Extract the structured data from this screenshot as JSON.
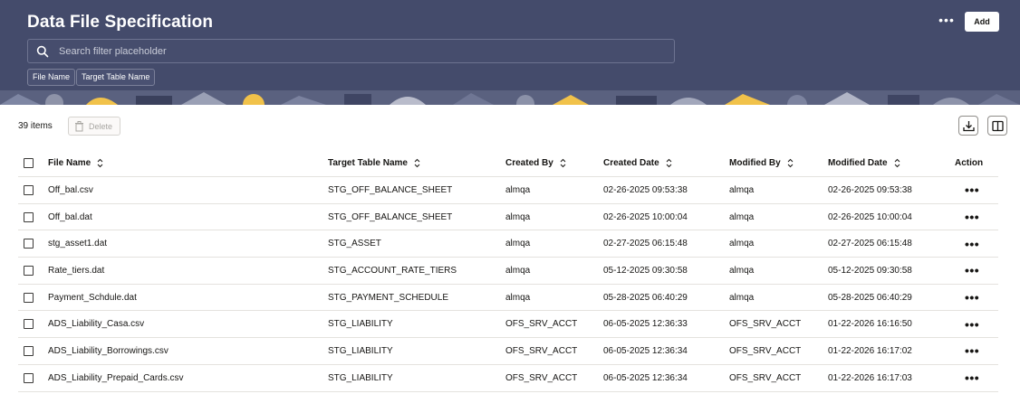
{
  "header": {
    "title": "Data File Specification",
    "search_placeholder": "Search filter placeholder",
    "chips": [
      "File Name",
      "Target Table Name"
    ],
    "more_label": "•••",
    "add_label": "Add",
    "background_color": "#444b6b"
  },
  "toolbar": {
    "item_count": "39 items",
    "delete_label": "Delete"
  },
  "table": {
    "columns": [
      "File Name",
      "Target Table Name",
      "Created By",
      "Created Date",
      "Modified By",
      "Modified Date",
      "Action"
    ],
    "action_label": "•••",
    "rows": [
      [
        "Off_bal.csv",
        "STG_OFF_BALANCE_SHEET",
        "almqa",
        "02-26-2025 09:53:38",
        "almqa",
        "02-26-2025 09:53:38"
      ],
      [
        "Off_bal.dat",
        "STG_OFF_BALANCE_SHEET",
        "almqa",
        "02-26-2025 10:00:04",
        "almqa",
        "02-26-2025 10:00:04"
      ],
      [
        "stg_asset1.dat",
        "STG_ASSET",
        "almqa",
        "02-27-2025 06:15:48",
        "almqa",
        "02-27-2025 06:15:48"
      ],
      [
        "Rate_tiers.dat",
        "STG_ACCOUNT_RATE_TIERS",
        "almqa",
        "05-12-2025 09:30:58",
        "almqa",
        "05-12-2025 09:30:58"
      ],
      [
        "Payment_Schdule.dat",
        "STG_PAYMENT_SCHEDULE",
        "almqa",
        "05-28-2025 06:40:29",
        "almqa",
        "05-28-2025 06:40:29"
      ],
      [
        "ADS_Liability_Casa.csv",
        "STG_LIABILITY",
        "OFS_SRV_ACCT",
        "06-05-2025 12:36:33",
        "OFS_SRV_ACCT",
        "01-22-2026 16:16:50"
      ],
      [
        "ADS_Liability_Borrowings.csv",
        "STG_LIABILITY",
        "OFS_SRV_ACCT",
        "06-05-2025 12:36:34",
        "OFS_SRV_ACCT",
        "01-22-2026 16:17:02"
      ],
      [
        "ADS_Liability_Prepaid_Cards.csv",
        "STG_LIABILITY",
        "OFS_SRV_ACCT",
        "06-05-2025 12:36:34",
        "OFS_SRV_ACCT",
        "01-22-2026 16:17:03"
      ]
    ]
  }
}
